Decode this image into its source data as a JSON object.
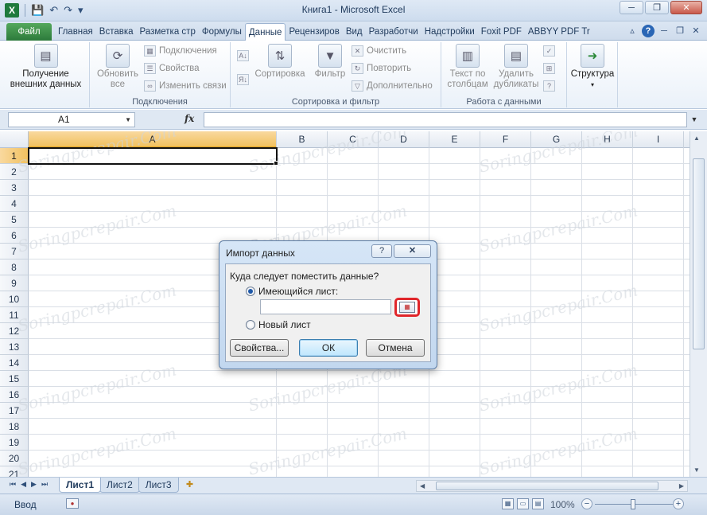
{
  "window": {
    "title": "Книга1  -  Microsoft Excel",
    "min_label": "─",
    "restore_label": "❐",
    "close_label": "✕"
  },
  "qat": {
    "app_icon": "X",
    "save_icon": "💾",
    "undo_icon": "↶",
    "redo_icon": "↷",
    "customize_icon": "▾"
  },
  "ribbon_tabs": [
    {
      "label": "Файл"
    },
    {
      "label": "Главная"
    },
    {
      "label": "Вставка"
    },
    {
      "label": "Разметка стр"
    },
    {
      "label": "Формулы"
    },
    {
      "label": "Данные"
    },
    {
      "label": "Рецензиров"
    },
    {
      "label": "Вид"
    },
    {
      "label": "Разработчи"
    },
    {
      "label": "Надстройки"
    },
    {
      "label": "Foxit PDF"
    },
    {
      "label": "ABBYY PDF Tr"
    }
  ],
  "ribbon": {
    "get_external": {
      "line1": "Получение",
      "line2": "внешних данных"
    },
    "refresh_all": {
      "line1": "Обновить",
      "line2": "все"
    },
    "connections": {
      "connections": "Подключения",
      "properties": "Свойства",
      "edit_links": "Изменить связи",
      "group": "Подключения"
    },
    "sort": {
      "sort": "Сортировка",
      "filter": "Фильтр",
      "clear": "Очистить",
      "reapply": "Повторить",
      "advanced": "Дополнительно",
      "group": "Сортировка и фильтр"
    },
    "tools": {
      "text_to_cols": "Текст по",
      "text_to_cols2": "столбцам",
      "remove_dup": "Удалить",
      "remove_dup2": "дубликаты",
      "group": "Работа с данными"
    },
    "outline": {
      "label": "Структура"
    }
  },
  "formula_bar": {
    "name_box": "A1",
    "fx": "fx",
    "formula": ""
  },
  "columns": [
    "A",
    "B",
    "C",
    "D",
    "E",
    "F",
    "G",
    "H",
    "I"
  ],
  "rows": [
    "1",
    "2",
    "3",
    "4",
    "5",
    "6",
    "7",
    "8",
    "9",
    "10",
    "11",
    "12",
    "13",
    "14",
    "15",
    "16",
    "17",
    "18",
    "19",
    "20",
    "21"
  ],
  "watermark": "Soringpcrepair.Com",
  "sheets": [
    {
      "label": "Лист1"
    },
    {
      "label": "Лист2"
    },
    {
      "label": "Лист3"
    }
  ],
  "status": {
    "mode": "Ввод",
    "zoom": "100%"
  },
  "dialog": {
    "title": "Импорт данных",
    "help": "?",
    "close": "✕",
    "question": "Куда следует поместить данные?",
    "existing_sheet": "Имеющийся лист:",
    "new_sheet": "Новый лист",
    "range_value": "",
    "properties": "Свойства...",
    "ok": "ОК",
    "cancel": "Отмена"
  }
}
